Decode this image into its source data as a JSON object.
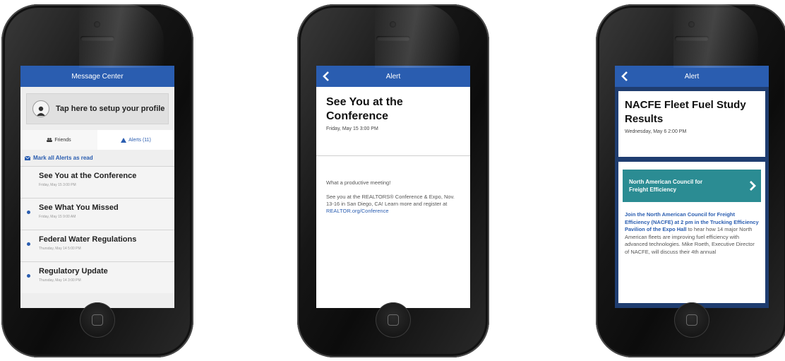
{
  "phone1": {
    "nav_title": "Message Center",
    "profile_prompt": "Tap here to setup your profile",
    "tabs": {
      "friends": "Friends",
      "alerts": "Alerts (11)"
    },
    "mark_all": "Mark all Alerts as read",
    "messages": [
      {
        "title": "See You at the Conference",
        "time": "Friday, May 15 3:00 PM",
        "unread": false
      },
      {
        "title": "See What You Missed",
        "time": "Friday, May 15 9:00 AM",
        "unread": true
      },
      {
        "title": "Federal Water Regulations",
        "time": "Thursday, May 14 5:00 PM",
        "unread": true
      },
      {
        "title": "Regulatory Update",
        "time": "Thursday, May 14 3:00 PM",
        "unread": true
      }
    ]
  },
  "phone2": {
    "nav_title": "Alert",
    "title": "See You at the Conference",
    "time": "Friday, May 15 3:00 PM",
    "body_1": "What a productive meeting!",
    "body_2": "See you at the REALTORS® Conference & Expo, Nov. 13-16 in San Diego, CA! Learn more and register at",
    "link": "REALTOR.org/Conference"
  },
  "phone3": {
    "nav_title": "Alert",
    "title": "NACFE Fleet Fuel Study Results",
    "time": "Wednesday, May 6 2:00 PM",
    "banner": "North American Council for Freight Efficiency",
    "body_bold": "Join the North American Council for Freight Efficiency (NACFE) at 2 pm in the Trucking Efficiency Pavilion of the Expo Hall",
    "body_rest": " to hear how 14 major North American fleets are improving fuel efficiency with advanced technologies. Mike Roeth, Executive Director of NACFE, will discuss their 4th annual"
  },
  "colors": {
    "nav_blue": "#2a5db0",
    "banner_teal": "#2b8c93"
  }
}
